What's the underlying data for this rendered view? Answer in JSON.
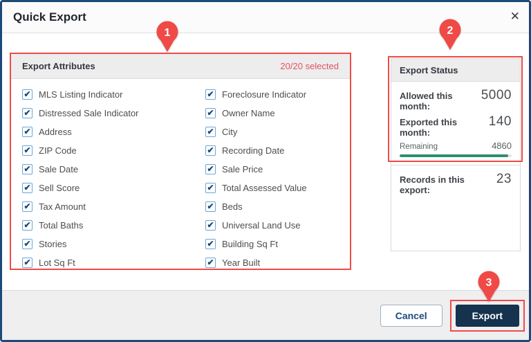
{
  "dialog": {
    "title": "Quick Export"
  },
  "icons": {
    "close": "✕",
    "check": "✔"
  },
  "annotations": {
    "markers": [
      {
        "label": "1"
      },
      {
        "label": "2"
      },
      {
        "label": "3"
      }
    ],
    "color": "#f04a47"
  },
  "attributes_panel": {
    "title": "Export Attributes",
    "selected_summary": "20/20 selected",
    "all_checked": true,
    "columns": {
      "left": [
        "MLS Listing Indicator",
        "Distressed Sale Indicator",
        "Address",
        "ZIP Code",
        "Sale Date",
        "Sell Score",
        "Tax Amount",
        "Total Baths",
        "Stories",
        "Lot Sq Ft"
      ],
      "right": [
        "Foreclosure Indicator",
        "Owner Name",
        "City",
        "Recording Date",
        "Sale Price",
        "Total Assessed Value",
        "Beds",
        "Universal Land Use",
        "Building Sq Ft",
        "Year Built"
      ]
    }
  },
  "status_panel": {
    "title": "Export Status",
    "rows": [
      {
        "label": "Allowed this month:",
        "value": "5000"
      },
      {
        "label": "Exported this month:",
        "value": "140"
      }
    ],
    "remaining": {
      "label": "Remaining",
      "value": "4860",
      "percent": 97.2
    },
    "records": {
      "label": "Records in this export:",
      "value": "23"
    }
  },
  "footer": {
    "cancel_label": "Cancel",
    "export_label": "Export"
  },
  "colors": {
    "accent_navy": "#1c4a78",
    "annotation_red": "#f04a47",
    "selected_red": "#e25360",
    "progress_green": "#2e8f6d",
    "checkbox_blue": "#6aa6d6"
  }
}
